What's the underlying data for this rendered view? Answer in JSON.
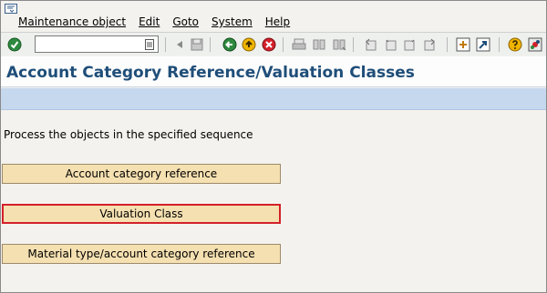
{
  "menubar": {
    "items": [
      "Maintenance object",
      "Edit",
      "Goto",
      "System",
      "Help"
    ]
  },
  "toolbar": {
    "command_value": "",
    "icons": [
      "enter-icon",
      "command-dropdown-icon",
      "back-arrow-icon",
      "save-icon",
      "back-icon",
      "exit-icon",
      "cancel-icon",
      "print-icon",
      "find-icon",
      "find-next-icon",
      "first-page-icon",
      "previous-page-icon",
      "next-page-icon",
      "last-page-icon",
      "create-session-icon",
      "shortcut-icon",
      "help-icon",
      "customize-layout-icon"
    ]
  },
  "page": {
    "title": "Account Category Reference/Valuation Classes"
  },
  "content": {
    "instruction": "Process the objects in the specified sequence",
    "buttons": [
      {
        "label": "Account category reference",
        "selected": false
      },
      {
        "label": "Valuation Class",
        "selected": true
      },
      {
        "label": "Material type/account category reference",
        "selected": false
      }
    ]
  },
  "colors": {
    "title": "#1f4e79",
    "app_toolbar": "#c6d8ee",
    "button_fill": "#f5e0b1",
    "selected_outline": "#d3202a"
  }
}
